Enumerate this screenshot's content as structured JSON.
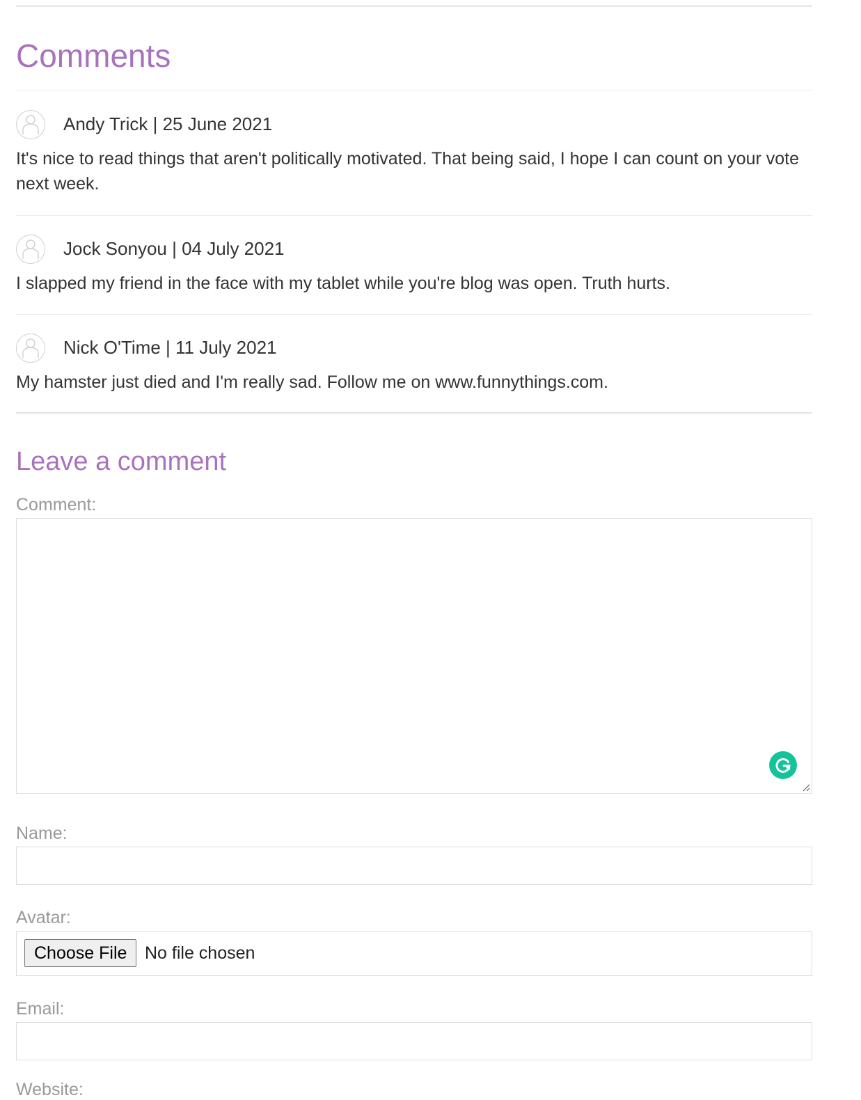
{
  "comments_section": {
    "heading": "Comments",
    "items": [
      {
        "author": "Andy Trick",
        "separator": "|",
        "date": "25 June 2021",
        "meta": "Andy Trick | 25 June 2021",
        "body": "It's nice to read things that aren't politically motivated. That being said, I hope I can count on your vote next week."
      },
      {
        "author": "Jock Sonyou",
        "separator": "|",
        "date": "04 July 2021",
        "meta": "Jock Sonyou | 04 July 2021",
        "body": "I slapped my friend in the face with my tablet while you're blog was open. Truth hurts."
      },
      {
        "author": "Nick O'Time",
        "separator": "|",
        "date": "11 July 2021",
        "meta": "Nick O'Time | 11 July 2021",
        "body": "My hamster just died and I'm really sad. Follow me on www.funnythings.com."
      }
    ]
  },
  "form": {
    "heading": "Leave a comment",
    "comment_label": "Comment:",
    "comment_value": "",
    "name_label": "Name:",
    "name_value": "",
    "avatar_label": "Avatar:",
    "choose_file_label": "Choose File",
    "file_status": "No file chosen",
    "email_label": "Email:",
    "email_value": "",
    "website_label": "Website:"
  },
  "icons": {
    "avatar": "user-avatar-icon",
    "grammarly": "grammarly-icon",
    "resize": "resize-handle-icon"
  },
  "colors": {
    "heading": "#a972bd",
    "label": "#999999",
    "text": "#333333",
    "grammarly": "#15c39a"
  }
}
